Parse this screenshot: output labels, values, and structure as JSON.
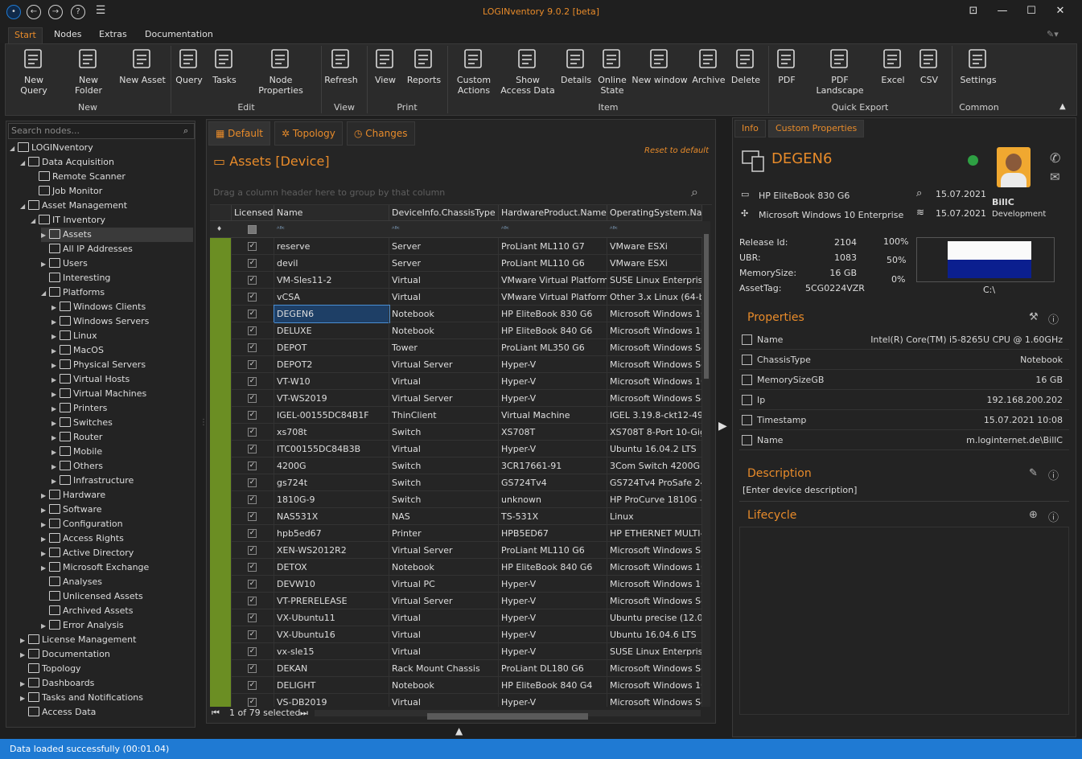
{
  "title_bar": {
    "app_title": "LOGINventory 9.0.2 [beta]",
    "icons": [
      "logo-icon",
      "back-icon",
      "forward-icon",
      "help-icon",
      "settings-icon"
    ]
  },
  "ribbon_tabs": [
    "Start",
    "Nodes",
    "Extras",
    "Documentation"
  ],
  "ribbon": {
    "buttons": [
      {
        "label": "New Query",
        "icon": "new-query-icon"
      },
      {
        "label": "New Folder",
        "icon": "new-folder-icon"
      },
      {
        "label": "New Asset",
        "icon": "new-asset-icon"
      },
      {
        "label": "Query",
        "icon": "query-icon"
      },
      {
        "label": "Tasks",
        "icon": "tasks-icon"
      },
      {
        "label": "Node Properties",
        "icon": "node-properties-icon"
      },
      {
        "label": "Refresh",
        "icon": "refresh-icon"
      },
      {
        "label": "View",
        "icon": "view-icon"
      },
      {
        "label": "Reports",
        "icon": "reports-icon"
      },
      {
        "label": "Custom Actions",
        "icon": "custom-actions-icon"
      },
      {
        "label": "Show Access Data",
        "icon": "key-icon"
      },
      {
        "label": "Details",
        "icon": "details-icon"
      },
      {
        "label": "Online State",
        "icon": "online-state-icon"
      },
      {
        "label": "New window",
        "icon": "new-window-icon"
      },
      {
        "label": "Archive",
        "icon": "archive-icon"
      },
      {
        "label": "Delete",
        "icon": "delete-icon"
      },
      {
        "label": "PDF",
        "icon": "pdf-icon"
      },
      {
        "label": "PDF Landscape",
        "icon": "pdf-landscape-icon"
      },
      {
        "label": "Excel",
        "icon": "excel-icon"
      },
      {
        "label": "CSV",
        "icon": "csv-icon"
      },
      {
        "label": "Settings",
        "icon": "settings-sliders-icon"
      }
    ],
    "groups": [
      "New",
      "Edit",
      "View",
      "Print",
      "Item",
      "Quick Export",
      "Common"
    ]
  },
  "tree": {
    "search_placeholder": "Search nodes...",
    "nodes": [
      "LOGINventory",
      "Data Acquisition",
      "Remote Scanner",
      "Job Monitor",
      "Asset Management",
      "IT Inventory",
      "Assets",
      "All IP Addresses",
      "Users",
      "Interesting",
      "Platforms",
      "Windows Clients",
      "Windows Servers",
      "Linux",
      "MacOS",
      "Physical Servers",
      "Virtual Hosts",
      "Virtual Machines",
      "Printers",
      "Switches",
      "Router",
      "Mobile",
      "Others",
      "Infrastructure",
      "Hardware",
      "Software",
      "Configuration",
      "Access Rights",
      "Active Directory",
      "Microsoft Exchange",
      "Analyses",
      "Unlicensed Assets",
      "Archived Assets",
      "Error Analysis",
      "License Management",
      "Documentation",
      "Topology",
      "Dashboards",
      "Tasks and Notifications",
      "Access Data"
    ]
  },
  "center": {
    "tabs": [
      "Default",
      "Topology",
      "Changes"
    ],
    "title": "Assets  [Device]",
    "reset": "Reset to default",
    "groupby": "Drag a column header here to group by that column",
    "columns": [
      "Licensed",
      "Name",
      "DeviceInfo.ChassisType",
      "HardwareProduct.Name",
      "OperatingSystem.Name"
    ],
    "rows": [
      [
        "reserve",
        "Server",
        "ProLiant ML110 G7",
        "VMware ESXi"
      ],
      [
        "devil",
        "Server",
        "ProLiant ML110 G6",
        "VMware ESXi"
      ],
      [
        "VM-Sles11-2",
        "Virtual",
        "VMware Virtual Platform",
        "SUSE Linux Enterprise"
      ],
      [
        "vCSA",
        "Virtual",
        "VMware Virtual Platform",
        "Other 3.x Linux (64-bit"
      ],
      [
        "DEGEN6",
        "Notebook",
        "HP EliteBook 830 G6",
        "Microsoft Windows 10 I"
      ],
      [
        "DELUXE",
        "Notebook",
        "HP EliteBook 840 G6",
        "Microsoft Windows 10 I"
      ],
      [
        "DEPOT",
        "Tower",
        "ProLiant ML350 G6",
        "Microsoft Windows Ser"
      ],
      [
        "DEPOT2",
        "Virtual Server",
        "Hyper-V",
        "Microsoft Windows Ser"
      ],
      [
        "VT-W10",
        "Virtual",
        "Hyper-V",
        "Microsoft Windows 10 I"
      ],
      [
        "VT-WS2019",
        "Virtual Server",
        "Hyper-V",
        "Microsoft Windows Ser"
      ],
      [
        "IGEL-00155DC84B1F",
        "ThinClient",
        "Virtual Machine",
        "IGEL 3.19.8-ckt12-49.5"
      ],
      [
        "xs708t",
        "Switch",
        "XS708T",
        "XS708T 8-Port 10-Giga"
      ],
      [
        "ITC00155DC84B3B",
        "Virtual",
        "Hyper-V",
        "Ubuntu 16.04.2 LTS"
      ],
      [
        "4200G",
        "Switch",
        "3CR17661-91",
        "3Com Switch 4200G 24"
      ],
      [
        "gs724t",
        "Switch",
        "GS724Tv4",
        "GS724Tv4 ProSafe 24-"
      ],
      [
        "1810G-9",
        "Switch",
        "unknown",
        "HP ProCurve 1810G - 8"
      ],
      [
        "NAS531X",
        "NAS",
        "TS-531X",
        "Linux"
      ],
      [
        "hpb5ed67",
        "Printer",
        "HPB5ED67",
        "HP ETHERNET MULTI-E"
      ],
      [
        "XEN-WS2012R2",
        "Virtual Server",
        "ProLiant ML110 G6",
        "Microsoft Windows Ser"
      ],
      [
        "DETOX",
        "Notebook",
        "HP EliteBook 840 G6",
        "Microsoft Windows 10 I"
      ],
      [
        "DEVW10",
        "Virtual PC",
        "Hyper-V",
        "Microsoft Windows 10 I"
      ],
      [
        "VT-PRERELEASE",
        "Virtual Server",
        "Hyper-V",
        "Microsoft Windows Ser"
      ],
      [
        "VX-Ubuntu11",
        "Virtual",
        "Hyper-V",
        "Ubuntu precise (12.04."
      ],
      [
        "VX-Ubuntu16",
        "Virtual",
        "Hyper-V",
        "Ubuntu 16.04.6 LTS"
      ],
      [
        "vx-sle15",
        "Virtual",
        "Hyper-V",
        "SUSE Linux Enterprise S"
      ],
      [
        "DEKAN",
        "Rack Mount Chassis",
        "ProLiant DL180 G6",
        "Microsoft Windows Ser"
      ],
      [
        "DELIGHT",
        "Notebook",
        "HP EliteBook 840 G4",
        "Microsoft Windows 10 I"
      ],
      [
        "VS-DB2019",
        "Virtual",
        "Hyper-V",
        "Microsoft Windows Ser"
      ]
    ],
    "footer": "1 of 79 selected"
  },
  "info": {
    "tabs": [
      "Info",
      "Custom Properties"
    ],
    "device": "DEGEN6",
    "hw": "HP EliteBook 830 G6",
    "os": "Microsoft Windows 10 Enterprise",
    "date1": "15.07.2021",
    "date2": "15.07.2021",
    "user": "BillC",
    "dept": "Development",
    "kv": [
      [
        "Release Id:",
        "2104"
      ],
      [
        "UBR:",
        "1083"
      ],
      [
        "MemorySize:",
        "16 GB"
      ],
      [
        "AssetTag:",
        "5CG0224VZR"
      ]
    ],
    "chart": {
      "ticks": [
        "100%",
        "50%",
        "0%"
      ],
      "label": "C:\\",
      "used_pct": 50
    },
    "properties_title": "Properties",
    "properties": [
      [
        "Name",
        "Intel(R) Core(TM) i5-8265U CPU @ 1.60GHz"
      ],
      [
        "ChassisType",
        "Notebook"
      ],
      [
        "MemorySizeGB",
        "16 GB"
      ],
      [
        "Ip",
        "192.168.200.202"
      ],
      [
        "Timestamp",
        "15.07.2021 10:08"
      ],
      [
        "Name",
        "m.loginternet.de\\BillC"
      ]
    ],
    "description_title": "Description",
    "description": "[Enter device description]",
    "lifecycle_title": "Lifecycle"
  },
  "status": "Data loaded successfully (00:01.04)"
}
